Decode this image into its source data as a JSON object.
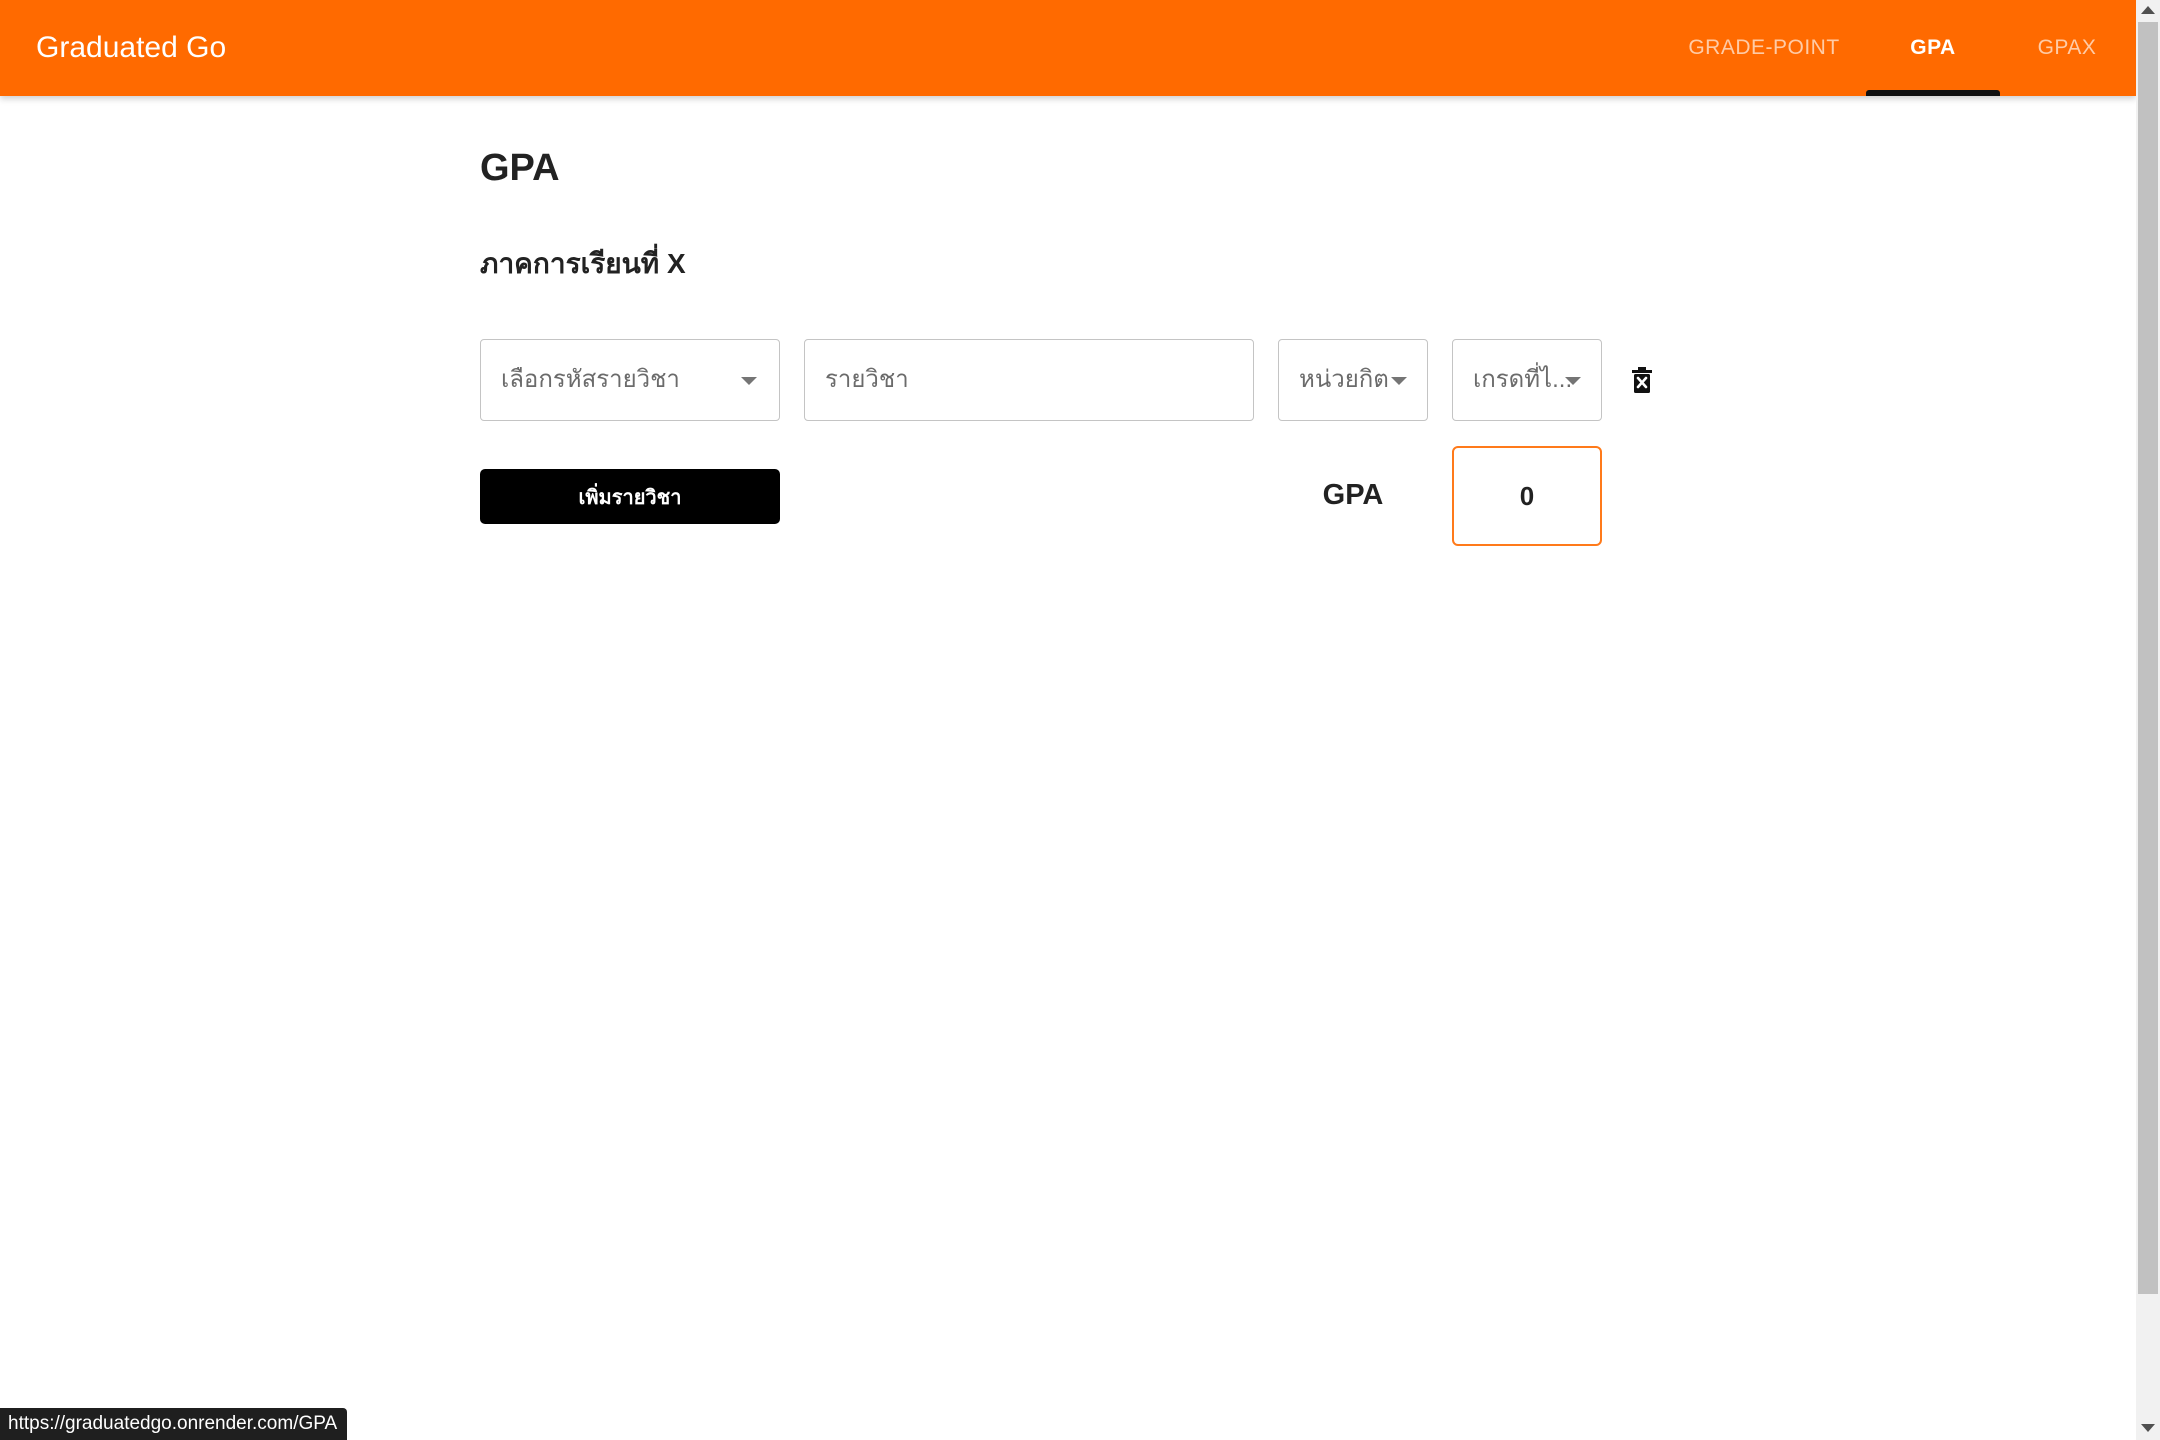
{
  "appbar": {
    "brand": "Graduated Go",
    "tabs": [
      {
        "label": "GRADE-POINT",
        "active": false
      },
      {
        "label": "GPA",
        "active": true
      },
      {
        "label": "GPAX",
        "active": false
      }
    ],
    "color": "#ff6a00"
  },
  "main": {
    "title": "GPA",
    "semester_title": "ภาคการเรียนที่ X",
    "course_row": {
      "code_select_placeholder": "เลือกรหัสรายวิชา",
      "name_input_placeholder": "รายวิชา",
      "credit_select_placeholder": "หน่วยกิต",
      "grade_select_placeholder": "เกรดที่ไ..."
    },
    "add_course_label": "เพิ่มรายวิชา",
    "gpa_label": "GPA",
    "gpa_value": "0",
    "accent_color": "#ff7a1a"
  },
  "icons": {
    "delete": "trash-x-icon",
    "dropdown": "caret-down-icon"
  },
  "status_bar": {
    "url": "https://graduatedgo.onrender.com/GPA"
  }
}
